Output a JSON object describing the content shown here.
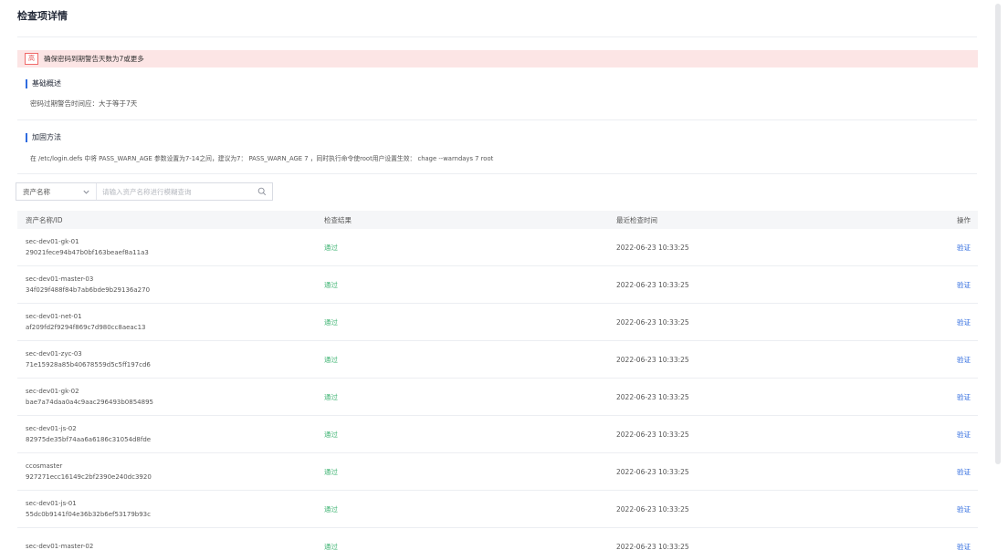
{
  "header": {
    "title": "检查项详情"
  },
  "alert": {
    "tag": "高",
    "text": "确保密码到期警告天数为7或更多"
  },
  "basic": {
    "heading": "基础概述",
    "text": "密码过期警告时间应：大于等于7天"
  },
  "fix": {
    "heading": "加固方法",
    "text": "在 /etc/login.defs 中将 PASS_WARN_AGE 参数设置为7-14之间，建议为7： PASS_WARN_AGE 7 ，同时执行命令使root用户设置生效： chage --warndays 7 root"
  },
  "filter": {
    "select_label": "资产名称",
    "placeholder": "请输入资产名称进行模糊查询"
  },
  "table": {
    "columns": [
      "资产名称/ID",
      "检查结果",
      "最近检查时间",
      "操作"
    ],
    "rows": [
      {
        "name": "sec-dev01-gk-01",
        "id": "29021fece94b47b0bf163beaef8a11a3",
        "result": "通过",
        "time": "2022-06-23 10:33:25",
        "action": "验证"
      },
      {
        "name": "sec-dev01-master-03",
        "id": "34f029f488f84b7ab6bde9b29136a270",
        "result": "通过",
        "time": "2022-06-23 10:33:25",
        "action": "验证"
      },
      {
        "name": "sec-dev01-net-01",
        "id": "af209fd2f9294f869c7d980cc8aeac13",
        "result": "通过",
        "time": "2022-06-23 10:33:25",
        "action": "验证"
      },
      {
        "name": "sec-dev01-zyc-03",
        "id": "71e15928a85b40678559d5c5ff197cd6",
        "result": "通过",
        "time": "2022-06-23 10:33:25",
        "action": "验证"
      },
      {
        "name": "sec-dev01-gk-02",
        "id": "bae7a74daa0a4c9aac296493b0854895",
        "result": "通过",
        "time": "2022-06-23 10:33:25",
        "action": "验证"
      },
      {
        "name": "sec-dev01-js-02",
        "id": "82975de35bf74aa6a6186c31054d8fde",
        "result": "通过",
        "time": "2022-06-23 10:33:25",
        "action": "验证"
      },
      {
        "name": "ccosmaster",
        "id": "927271ecc16149c2bf2390e240dc3920",
        "result": "通过",
        "time": "2022-06-23 10:33:25",
        "action": "验证"
      },
      {
        "name": "sec-dev01-js-01",
        "id": "55dc0b9141f04e36b32b6ef53179b93c",
        "result": "通过",
        "time": "2022-06-23 10:33:25",
        "action": "验证"
      },
      {
        "name": "sec-dev01-master-02",
        "id": "",
        "result": "通过",
        "time": "2022-06-23 10:33:25",
        "action": "验证"
      }
    ]
  },
  "icons": {
    "select_caret": "chevron-down-icon",
    "search": "search-icon"
  },
  "colors": {
    "accent": "#2f6bdf",
    "pass": "#3cb371",
    "alert_bg": "#fce5e5",
    "alert_border": "#f06a6a"
  }
}
